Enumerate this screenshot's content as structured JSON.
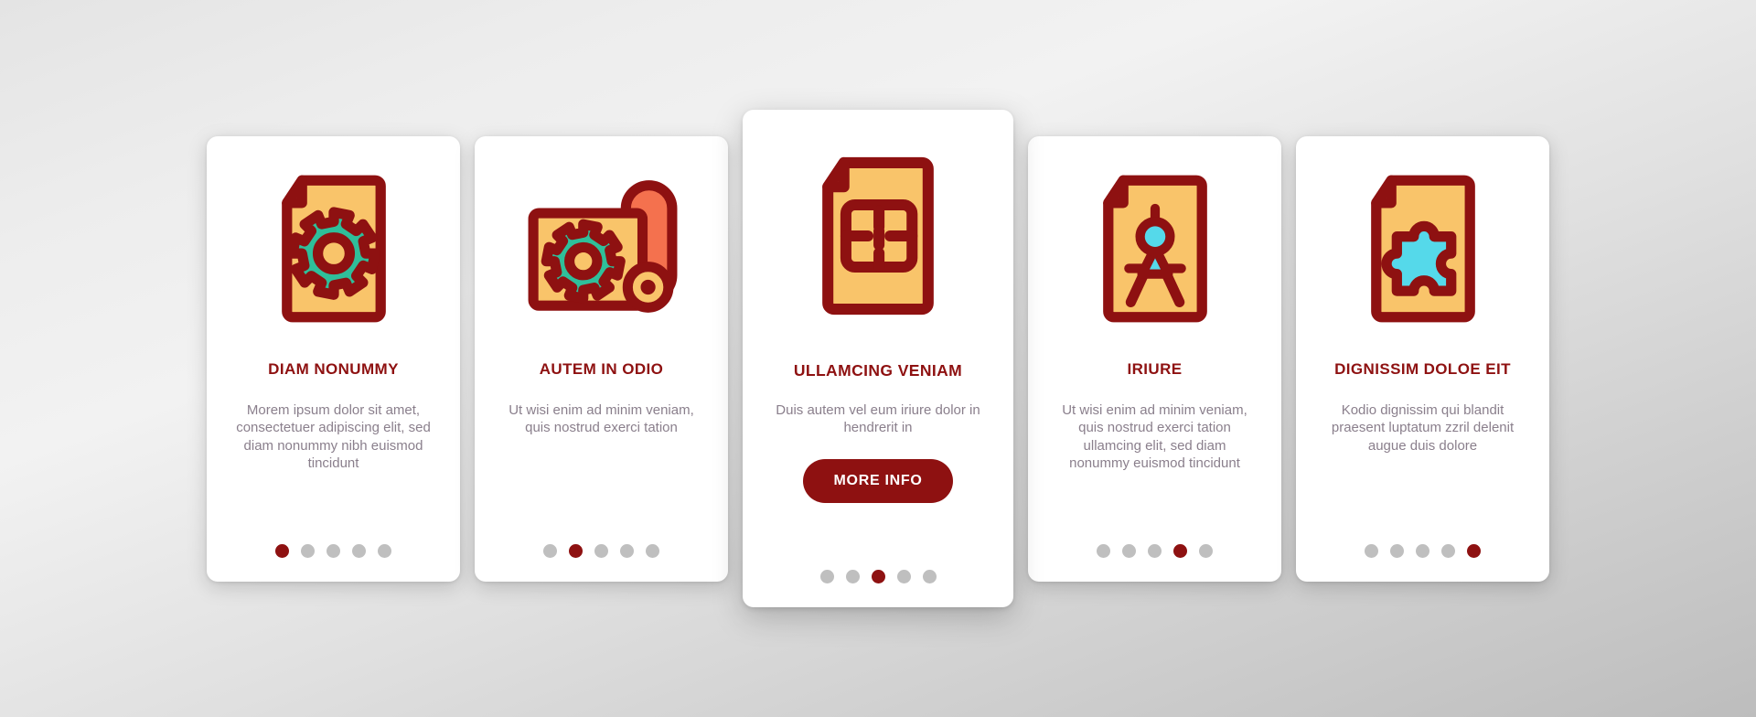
{
  "palette": {
    "background_light": "#f2f2f2",
    "background_dark": "#bdbdbd",
    "card_bg": "#ffffff",
    "accent_dark_red": "#8e1111",
    "icon_outline": "#8e1111",
    "icon_paper_fill": "#f9c46a",
    "icon_fold_fill": "#f4714e",
    "icon_roll_fill": "#f4714e",
    "icon_gear_fill": "#2fbf9a",
    "icon_cyan_fill": "#55d9ea",
    "text_body": "#8a7f8c",
    "dot_inactive": "#bfbfbf",
    "dot_active": "#8e1111",
    "button_bg": "#8e1111",
    "button_text": "#ffffff"
  },
  "cards": [
    {
      "id": "card-diam-nonummy",
      "icon": "document-gear-icon",
      "title": "DIAM NONUMMY",
      "description": "Morem ipsum dolor sit amet, consectetuer adipiscing elit, sed diam nonummy nibh euismod tincidunt",
      "featured": false,
      "dots_total": 5,
      "dot_active_index": 1,
      "button_label": null
    },
    {
      "id": "card-autem-in-odio",
      "icon": "blueprint-roll-gear-icon",
      "title": "AUTEM IN ODIO",
      "description": "Ut wisi enim ad minim veniam, quis nostrud exerci tation",
      "featured": false,
      "dots_total": 5,
      "dot_active_index": 2,
      "button_label": null
    },
    {
      "id": "card-ullamcing-veniam",
      "icon": "document-floorplan-icon",
      "title": "ULLAMCING VENIAM",
      "description": "Duis autem vel eum iriure dolor in hendrerit in",
      "featured": true,
      "dots_total": 5,
      "dot_active_index": 3,
      "button_label": "MORE INFO"
    },
    {
      "id": "card-iriure",
      "icon": "document-compass-icon",
      "title": "IRIURE",
      "description": "Ut wisi enim ad minim veniam, quis nostrud exerci tation ullamcing elit, sed diam nonummy euismod tincidunt",
      "featured": false,
      "dots_total": 5,
      "dot_active_index": 4,
      "button_label": null
    },
    {
      "id": "card-dignissim-doloe-eit",
      "icon": "document-puzzle-icon",
      "title": "DIGNISSIM DOLOE EIT",
      "description": "Kodio dignissim qui blandit praesent luptatum zzril delenit augue duis dolore",
      "featured": false,
      "dots_total": 5,
      "dot_active_index": 5,
      "button_label": null
    }
  ]
}
